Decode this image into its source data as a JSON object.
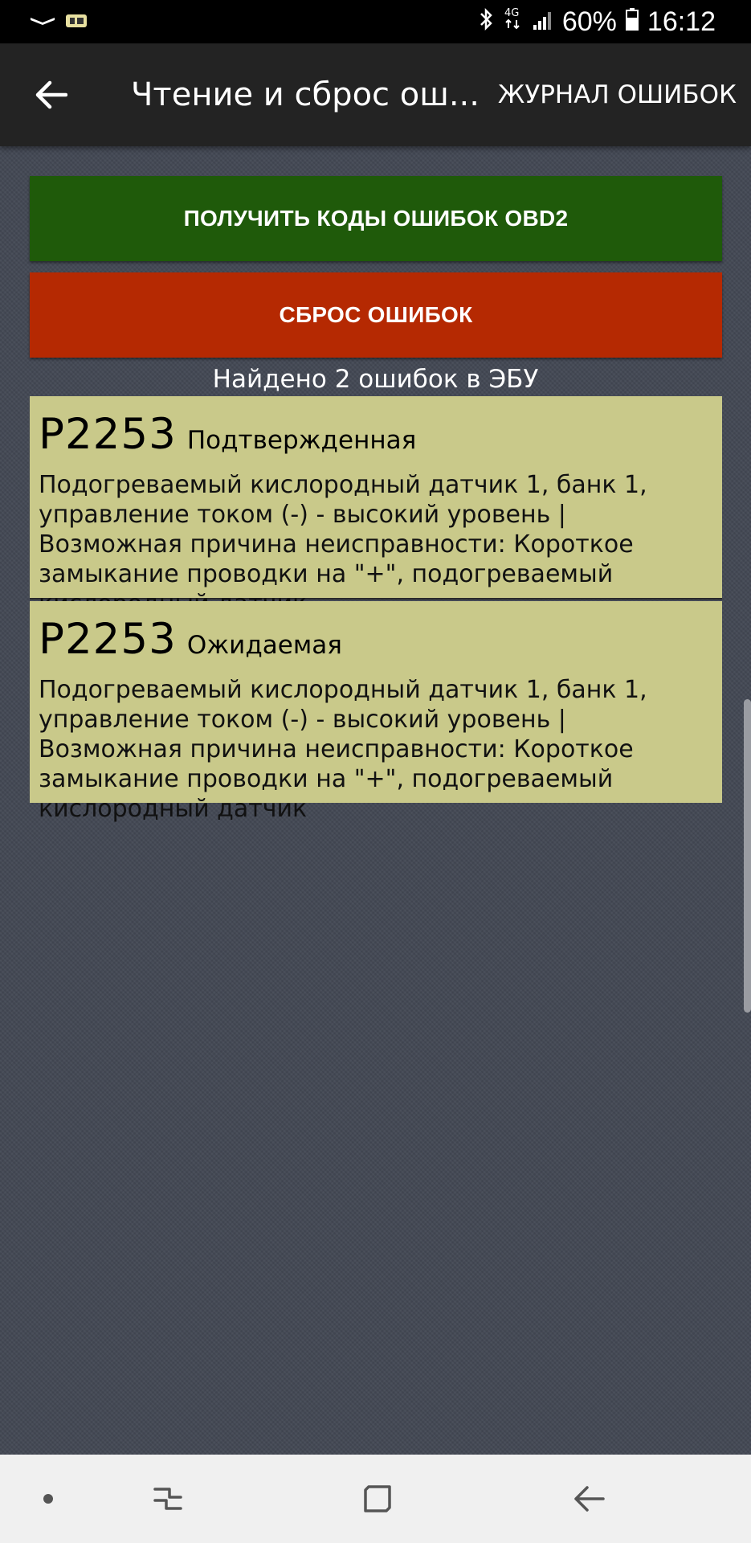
{
  "status_bar": {
    "icons": [
      "notification-app-icon-1",
      "notification-app-icon-2",
      "bluetooth-icon",
      "4g-data-icon",
      "signal-icon",
      "battery-icon"
    ],
    "network": "4G",
    "battery": "60%",
    "time": "16:12"
  },
  "toolbar": {
    "title": "Чтение и сброс ош...",
    "action": "ЖУРНАЛ ОШИБОК"
  },
  "buttons": {
    "read_codes": "ПОЛУЧИТЬ КОДЫ ОШИБОК OBD2",
    "reset_errors": "СБРОС ОШИБОК"
  },
  "found_summary": "Найдено 2 ошибок в ЭБУ",
  "errors": [
    {
      "code": "P2253",
      "status": "Подтвержденная",
      "description": "Подогреваемый кислородный датчик 1, банк 1, управление током (-) - высокий уровень | Возможная причина неисправности: Короткое замыкание проводки на \"+\", подогреваемый кислородный датчик"
    },
    {
      "code": "P2253",
      "status": "Ожидаемая",
      "description": "Подогреваемый кислородный датчик 1, банк 1, управление током (-) - высокий уровень | Возможная причина неисправности: Короткое замыкание проводки на \"+\", подогреваемый кислородный датчик"
    }
  ],
  "colors": {
    "read_button": "#1f5a0a",
    "reset_button": "#b52902",
    "error_card": "#c9c98a",
    "background": "#434854",
    "toolbar": "#232323"
  },
  "nav_bar": {
    "icons": [
      "dot-icon",
      "recent-apps-icon",
      "home-icon",
      "back-nav-icon"
    ]
  }
}
